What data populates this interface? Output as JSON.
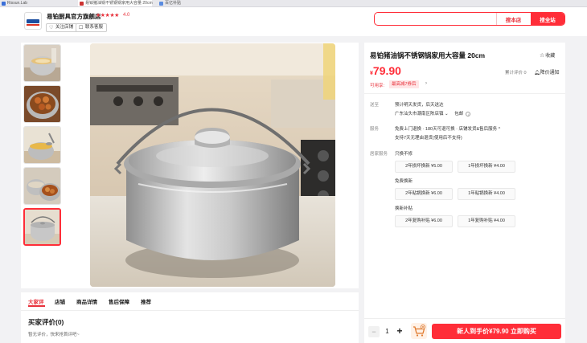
{
  "browser_tabs": [
    {
      "title": "Rissun.Lab"
    },
    {
      "title": "易铂猪油锅不锈钢锅家用大容量 20cm"
    },
    {
      "title": "百亿补贴"
    }
  ],
  "shop": {
    "name": "易铂厨具官方旗舰店",
    "stars": "★★★★★",
    "rating": "4.0",
    "follow_label": "关注店铺",
    "service_label": "联系客服"
  },
  "search": {
    "placeholder": "",
    "store_button": "搜本店",
    "site_button": "搜全站"
  },
  "gallery": {
    "selected_index": 4,
    "thumbnail_count": 5
  },
  "review_tabs": [
    "大家评",
    "店铺",
    "商品详情",
    "售后保障",
    "推荐"
  ],
  "reviews": {
    "title": "买家评价(0)",
    "empty_text": "暂无评价，快来抢首评吧~"
  },
  "product": {
    "title": "易铂猪油锅不锈钢锅家用大容量 20cm",
    "favorite_label": "收藏",
    "currency": "¥",
    "price": "79.90",
    "sales": "累计评价 0",
    "price_down_label": "降价通知",
    "enjoy_label": "可用享:",
    "coupon": "最高减7券后",
    "coupon_arrow": "›"
  },
  "delivery": {
    "label": "送至",
    "eta": "预计明天发货，后天送达",
    "address": "广东汕头市潮南区陈店镇",
    "shipping": "包邮"
  },
  "service": {
    "label": "服务",
    "line1": "免费上门退换 · 180天可退可换 · 店铺发货&售后服务",
    "line2": "支持7天无理由退货(使用后不支持)"
  },
  "home_service": {
    "label": "居家服务",
    "groups": [
      {
        "name": "只换不修",
        "options": [
          "2年损坏换新 ¥5.00",
          "1年损坏换新 ¥4.00"
        ]
      },
      {
        "name": "免费换新",
        "options": [
          "2年粘锅换新 ¥6.00",
          "1年粘锅换新 ¥4.00"
        ]
      },
      {
        "name": "换新补贴",
        "options": [
          "2年复购补贴 ¥6.00",
          "1年复购补贴 ¥4.00"
        ]
      }
    ]
  },
  "purchase": {
    "qty_minus": "−",
    "quantity": "1",
    "qty_plus": "+",
    "buy_label": "新人到手价¥79.90 立即购买"
  },
  "colors": {
    "accent": "#ff2d38",
    "panel": "#ffffff",
    "page_bg": "#f2f2f4"
  }
}
